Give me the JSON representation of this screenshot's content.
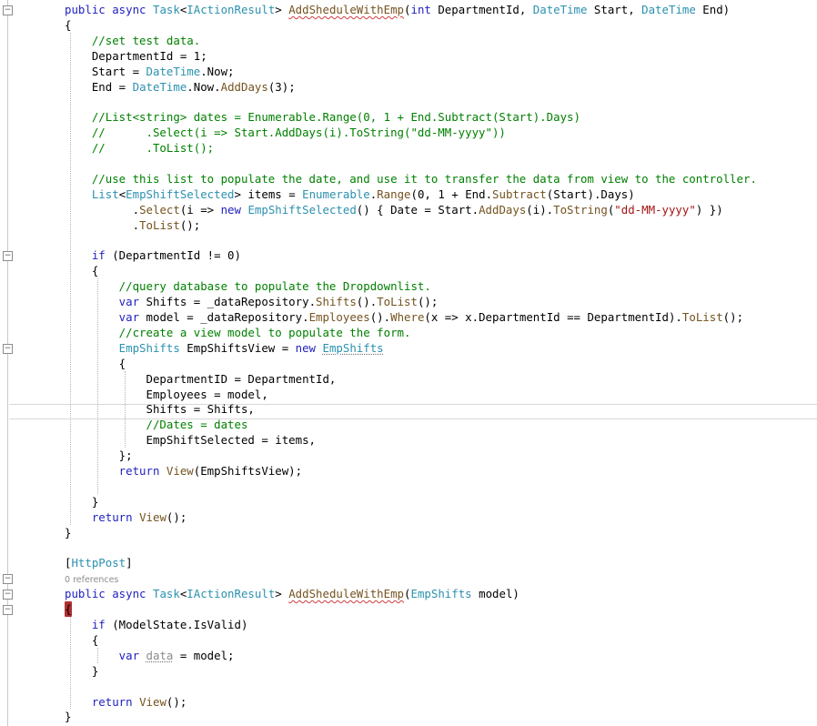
{
  "colors": {
    "keyword": "#1f1fbf",
    "type": "#2b91af",
    "comment": "#008000",
    "string": "#a31515",
    "method": "#74531f",
    "plain": "#000000",
    "attribute": "#2b91af",
    "reference": "#8c8c8c"
  },
  "code_lines": [
    [
      {
        "t": "public ",
        "c": "keyword"
      },
      {
        "t": "async ",
        "c": "keyword"
      },
      {
        "t": "Task",
        "c": "type"
      },
      {
        "t": "<",
        "c": "plain"
      },
      {
        "t": "IActionResult",
        "c": "type"
      },
      {
        "t": "> ",
        "c": "plain"
      },
      {
        "t": "AddSheduleWithEmp",
        "c": "method",
        "squiggle": true
      },
      {
        "t": "(",
        "c": "plain"
      },
      {
        "t": "int ",
        "c": "keyword"
      },
      {
        "t": "DepartmentId, ",
        "c": "plain"
      },
      {
        "t": "DateTime ",
        "c": "type"
      },
      {
        "t": "Start, ",
        "c": "plain"
      },
      {
        "t": "DateTime ",
        "c": "type"
      },
      {
        "t": "End)",
        "c": "plain"
      }
    ],
    [
      {
        "t": "{",
        "c": "plain"
      }
    ],
    [
      {
        "t": "    //set test data.",
        "c": "comment"
      }
    ],
    [
      {
        "t": "    DepartmentId = 1;",
        "c": "plain"
      }
    ],
    [
      {
        "t": "    Start = ",
        "c": "plain"
      },
      {
        "t": "DateTime",
        "c": "type"
      },
      {
        "t": ".Now;",
        "c": "plain"
      }
    ],
    [
      {
        "t": "    End = ",
        "c": "plain"
      },
      {
        "t": "DateTime",
        "c": "type"
      },
      {
        "t": ".Now.",
        "c": "plain"
      },
      {
        "t": "AddDays",
        "c": "method"
      },
      {
        "t": "(3);",
        "c": "plain"
      }
    ],
    [],
    [
      {
        "t": "    //List<string> dates = Enumerable.Range(0, 1 + End.Subtract(Start).Days)",
        "c": "comment"
      }
    ],
    [
      {
        "t": "    //      .Select(i => Start.AddDays(i).ToString(\"dd-MM-yyyy\"))",
        "c": "comment"
      }
    ],
    [
      {
        "t": "    //      .ToList();",
        "c": "comment"
      }
    ],
    [],
    [
      {
        "t": "    //use this list to populate the date, and use it to transfer the data from view to the controller.",
        "c": "comment"
      }
    ],
    [
      {
        "t": "    List",
        "c": "type"
      },
      {
        "t": "<",
        "c": "plain"
      },
      {
        "t": "EmpShiftSelected",
        "c": "type"
      },
      {
        "t": "> items = ",
        "c": "plain"
      },
      {
        "t": "Enumerable",
        "c": "type"
      },
      {
        "t": ".",
        "c": "plain"
      },
      {
        "t": "Range",
        "c": "method"
      },
      {
        "t": "(0, 1 + End.",
        "c": "plain"
      },
      {
        "t": "Subtract",
        "c": "method"
      },
      {
        "t": "(Start).Days)",
        "c": "plain"
      }
    ],
    [
      {
        "t": "          .",
        "c": "plain"
      },
      {
        "t": "Select",
        "c": "method"
      },
      {
        "t": "(i => ",
        "c": "plain"
      },
      {
        "t": "new ",
        "c": "keyword"
      },
      {
        "t": "EmpShiftSelected",
        "c": "type"
      },
      {
        "t": "() { Date = Start.",
        "c": "plain"
      },
      {
        "t": "AddDays",
        "c": "method"
      },
      {
        "t": "(i).",
        "c": "plain"
      },
      {
        "t": "ToString",
        "c": "method"
      },
      {
        "t": "(",
        "c": "plain"
      },
      {
        "t": "\"dd-MM-yyyy\"",
        "c": "string"
      },
      {
        "t": ") })",
        "c": "plain"
      }
    ],
    [
      {
        "t": "          .",
        "c": "plain"
      },
      {
        "t": "ToList",
        "c": "method"
      },
      {
        "t": "();",
        "c": "plain"
      }
    ],
    [],
    [
      {
        "t": "    if ",
        "c": "keyword"
      },
      {
        "t": "(DepartmentId != 0)",
        "c": "plain"
      }
    ],
    [
      {
        "t": "    {",
        "c": "plain"
      }
    ],
    [
      {
        "t": "        //query database to populate the Dropdownlist.",
        "c": "comment"
      }
    ],
    [
      {
        "t": "        var ",
        "c": "keyword"
      },
      {
        "t": "Shifts = _dataRepository.",
        "c": "plain"
      },
      {
        "t": "Shifts",
        "c": "method"
      },
      {
        "t": "().",
        "c": "plain"
      },
      {
        "t": "ToList",
        "c": "method"
      },
      {
        "t": "();",
        "c": "plain"
      }
    ],
    [
      {
        "t": "        var ",
        "c": "keyword"
      },
      {
        "t": "model = _dataRepository.",
        "c": "plain"
      },
      {
        "t": "Employees",
        "c": "method"
      },
      {
        "t": "().",
        "c": "plain"
      },
      {
        "t": "Where",
        "c": "method"
      },
      {
        "t": "(x => x.DepartmentId == DepartmentId).",
        "c": "plain"
      },
      {
        "t": "ToList",
        "c": "method"
      },
      {
        "t": "();",
        "c": "plain"
      }
    ],
    [
      {
        "t": "        //create a view model to populate the form.",
        "c": "comment"
      }
    ],
    [
      {
        "t": "        EmpShifts ",
        "c": "type"
      },
      {
        "t": "EmpShiftsView = ",
        "c": "plain"
      },
      {
        "t": "new ",
        "c": "keyword"
      },
      {
        "t": "EmpShifts",
        "c": "type",
        "dotted": true
      }
    ],
    [
      {
        "t": "        {",
        "c": "plain"
      }
    ],
    [
      {
        "t": "            DepartmentID = DepartmentId,",
        "c": "plain"
      }
    ],
    [
      {
        "t": "            Employees = model,",
        "c": "plain"
      }
    ],
    [
      {
        "t": "            Shifts = Shifts,",
        "c": "plain"
      }
    ],
    [
      {
        "t": "            //Dates = dates",
        "c": "comment"
      }
    ],
    [
      {
        "t": "            EmpShiftSelected = items,",
        "c": "plain"
      }
    ],
    [
      {
        "t": "        };",
        "c": "plain"
      }
    ],
    [
      {
        "t": "        return ",
        "c": "keyword"
      },
      {
        "t": "View",
        "c": "method"
      },
      {
        "t": "(EmpShiftsView);",
        "c": "plain"
      }
    ],
    [],
    [
      {
        "t": "    }",
        "c": "plain"
      }
    ],
    [
      {
        "t": "    return ",
        "c": "keyword"
      },
      {
        "t": "View",
        "c": "method"
      },
      {
        "t": "();",
        "c": "plain"
      }
    ],
    [
      {
        "t": "}",
        "c": "plain"
      }
    ],
    [],
    [
      {
        "t": "[",
        "c": "plain"
      },
      {
        "t": "HttpPost",
        "c": "attribute"
      },
      {
        "t": "]",
        "c": "plain"
      }
    ],
    [
      {
        "t": "0 references",
        "c": "reference",
        "ref": true
      }
    ],
    [
      {
        "t": "public ",
        "c": "keyword"
      },
      {
        "t": "async ",
        "c": "keyword"
      },
      {
        "t": "Task",
        "c": "type"
      },
      {
        "t": "<",
        "c": "plain"
      },
      {
        "t": "IActionResult",
        "c": "type"
      },
      {
        "t": "> ",
        "c": "plain"
      },
      {
        "t": "AddSheduleWithEmp",
        "c": "method",
        "squiggle": true
      },
      {
        "t": "(",
        "c": "plain"
      },
      {
        "t": "EmpShifts ",
        "c": "type"
      },
      {
        "t": "model)",
        "c": "plain"
      }
    ],
    [
      {
        "t": "{",
        "c": "plain",
        "brace": true
      }
    ],
    [
      {
        "t": "    if ",
        "c": "keyword"
      },
      {
        "t": "(ModelState.IsValid)",
        "c": "plain"
      }
    ],
    [
      {
        "t": "    {",
        "c": "plain"
      }
    ],
    [
      {
        "t": "        var ",
        "c": "keyword"
      },
      {
        "t": "data",
        "c": "reference",
        "dotted": true
      },
      {
        "t": " = model;",
        "c": "plain"
      }
    ],
    [
      {
        "t": "    }",
        "c": "plain"
      }
    ],
    [],
    [
      {
        "t": "    return ",
        "c": "keyword"
      },
      {
        "t": "View",
        "c": "method"
      },
      {
        "t": "();",
        "c": "plain"
      }
    ],
    [
      {
        "t": "}",
        "c": "plain"
      }
    ]
  ],
  "fold_markers": [
    "−",
    "−",
    "−",
    "−",
    "−",
    "−"
  ]
}
